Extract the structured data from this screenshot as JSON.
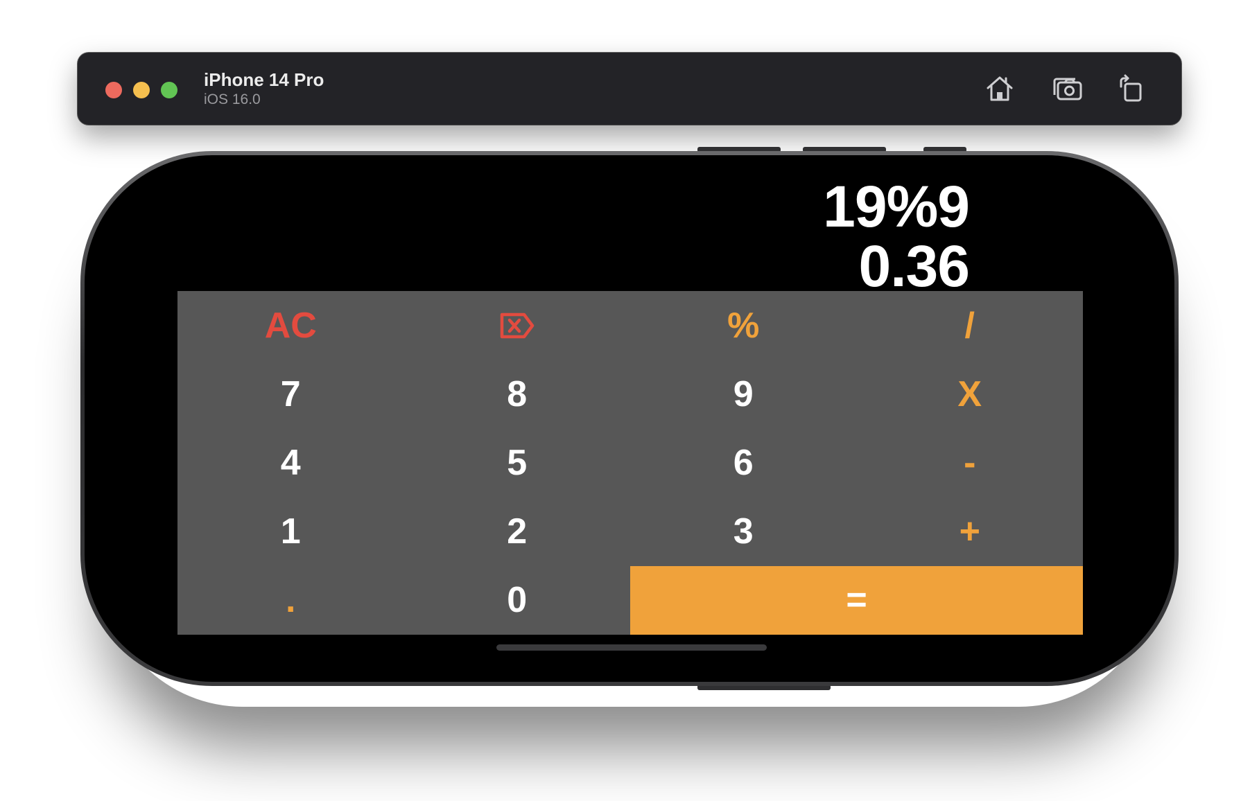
{
  "simulator": {
    "device_name": "iPhone 14 Pro",
    "os_version": "iOS 16.0",
    "toolbar_icons": [
      "home-icon",
      "screenshot-icon",
      "rotate-icon"
    ]
  },
  "display": {
    "expression": "19%9",
    "result": "0.36"
  },
  "keypad": {
    "keys": [
      {
        "label": "AC",
        "color": "#e34b3f"
      },
      {
        "label": "",
        "icon": "backspace-icon",
        "color": "#e34b3f"
      },
      {
        "label": "%",
        "color": "#f0a23b"
      },
      {
        "label": "/",
        "color": "#f0a23b"
      },
      {
        "label": "7",
        "color": "#ffffff"
      },
      {
        "label": "8",
        "color": "#ffffff"
      },
      {
        "label": "9",
        "color": "#ffffff"
      },
      {
        "label": "X",
        "color": "#f0a23b"
      },
      {
        "label": "4",
        "color": "#ffffff"
      },
      {
        "label": "5",
        "color": "#ffffff"
      },
      {
        "label": "6",
        "color": "#ffffff"
      },
      {
        "label": "-",
        "color": "#f0a23b"
      },
      {
        "label": "1",
        "color": "#ffffff"
      },
      {
        "label": "2",
        "color": "#ffffff"
      },
      {
        "label": "3",
        "color": "#ffffff"
      },
      {
        "label": "+",
        "color": "#f0a23b"
      },
      {
        "label": ".",
        "color": "#f0a23b"
      },
      {
        "label": "0",
        "color": "#ffffff"
      },
      {
        "label": "=",
        "color": "#ffffff"
      }
    ]
  },
  "colors": {
    "keypad_background": "#575757",
    "accent_orange": "#f0a23b",
    "accent_red": "#e34b3f",
    "screen_background": "#000000"
  }
}
